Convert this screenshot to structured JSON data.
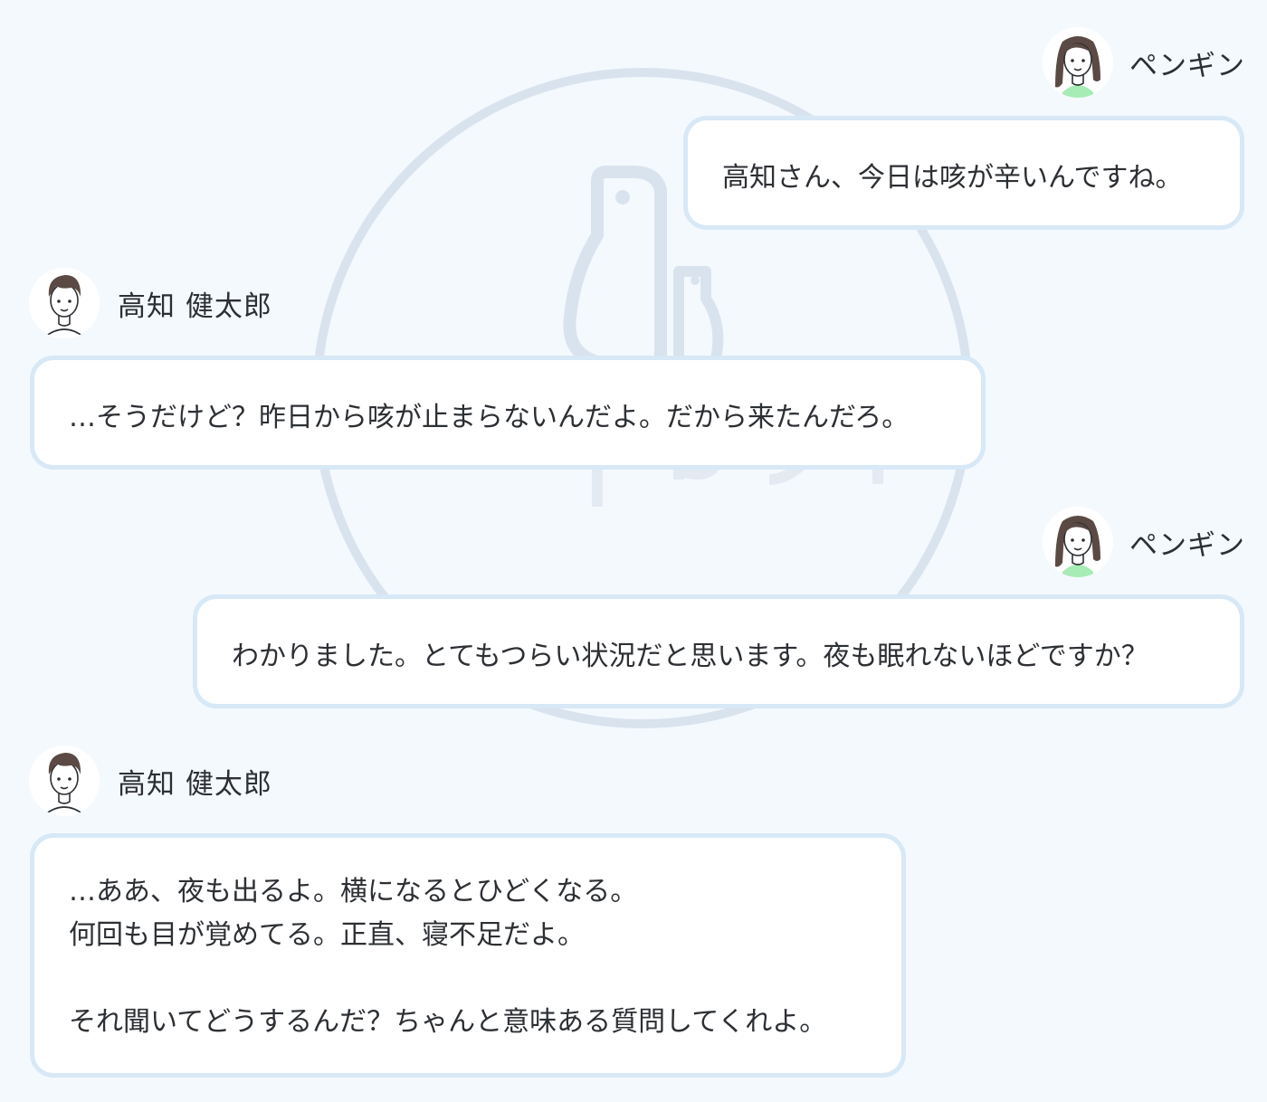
{
  "conversation": {
    "messages": [
      {
        "speaker": "ペンギン",
        "role": "assistant",
        "lines": [
          "高知さん、今日は咳が辛いんですね。"
        ]
      },
      {
        "speaker": "高知 健太郎",
        "role": "patient",
        "lines": [
          "…そうだけど？昨日から咳が止まらないんだよ。だから来たんだろ。"
        ]
      },
      {
        "speaker": "ペンギン",
        "role": "assistant",
        "lines": [
          "わかりました。とてもつらい状況だと思います。夜も眠れないほどですか？"
        ]
      },
      {
        "speaker": "高知 健太郎",
        "role": "patient",
        "lines": [
          "…ああ、夜も出るよ。横になるとひどくなる。",
          "何回も目が覚めてる。正直、寝不足だよ。",
          "",
          "それ聞いてどうするんだ？ちゃんと意味ある質問してくれよ。"
        ]
      }
    ]
  },
  "colors": {
    "background": "#f4f9fe",
    "bubble_border": "#d7e8f6",
    "bubble_fill": "#ffffff",
    "text": "#2c2f33",
    "watermark": "#d9e3ee",
    "assistant_shirt": "#a6ecb4"
  },
  "icons": {
    "assistant_avatar": "woman-avatar-icon",
    "patient_avatar": "man-avatar-icon",
    "watermark": "penguin-logo-watermark"
  }
}
